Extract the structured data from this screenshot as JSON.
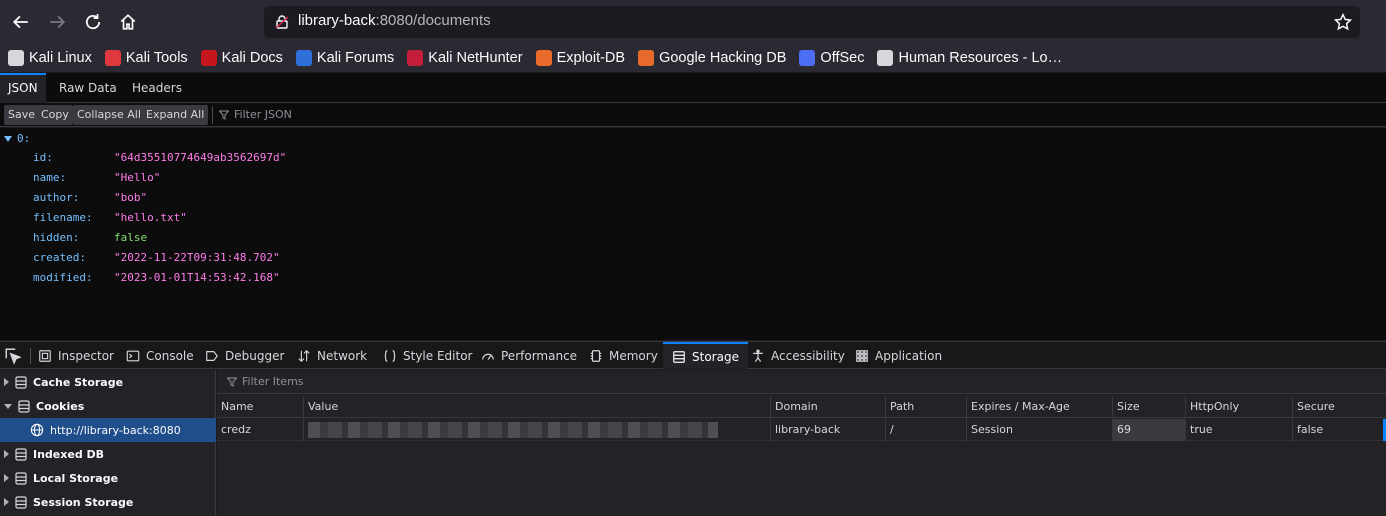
{
  "browser": {
    "url_host": "library-back",
    "url_rest": ":8080/documents",
    "bookmarks": [
      {
        "label": "Kali Linux",
        "color": "#d7d7db"
      },
      {
        "label": "Kali Tools",
        "color": "#e0383f"
      },
      {
        "label": "Kali Docs",
        "color": "#c4161c"
      },
      {
        "label": "Kali Forums",
        "color": "#2f6fdb"
      },
      {
        "label": "Kali NetHunter",
        "color": "#c41e3a"
      },
      {
        "label": "Exploit-DB",
        "color": "#e86a2b"
      },
      {
        "label": "Google Hacking DB",
        "color": "#e86a2b"
      },
      {
        "label": "OffSec",
        "color": "#4c6ef5"
      },
      {
        "label": "Human Resources - Lo…",
        "color": "#d7d7db"
      }
    ]
  },
  "json_viewer": {
    "tabs": [
      "JSON",
      "Raw Data",
      "Headers"
    ],
    "buttons": [
      "Save",
      "Copy",
      "Collapse All",
      "Expand All"
    ],
    "filter_placeholder": "Filter JSON",
    "root_key": "0:",
    "rows": [
      {
        "key": "id:",
        "value": "\"64d35510774649ab3562697d\"",
        "type": "str"
      },
      {
        "key": "name:",
        "value": "\"Hello\"",
        "type": "str"
      },
      {
        "key": "author:",
        "value": "\"bob\"",
        "type": "str"
      },
      {
        "key": "filename:",
        "value": "\"hello.txt\"",
        "type": "str"
      },
      {
        "key": "hidden:",
        "value": "false",
        "type": "bool"
      },
      {
        "key": "created:",
        "value": "\"2022-11-22T09:31:48.702\"",
        "type": "str"
      },
      {
        "key": "modified:",
        "value": "\"2023-01-01T14:53:42.168\"",
        "type": "str"
      }
    ]
  },
  "devtools": {
    "tabs": [
      "Inspector",
      "Console",
      "Debugger",
      "Network",
      "Style Editor",
      "Performance",
      "Memory",
      "Storage",
      "Accessibility",
      "Application"
    ],
    "active_tab": "Storage",
    "sidebar": [
      {
        "label": "Cache Storage",
        "state": "closed"
      },
      {
        "label": "Cookies",
        "state": "open"
      },
      {
        "label": "http://library-back:8080",
        "state": "selected"
      },
      {
        "label": "Indexed DB",
        "state": "closed"
      },
      {
        "label": "Local Storage",
        "state": "closed"
      },
      {
        "label": "Session Storage",
        "state": "closed"
      }
    ],
    "filter_placeholder": "Filter Items",
    "columns": [
      "Name",
      "Value",
      "Domain",
      "Path",
      "Expires / Max-Age",
      "Size",
      "HttpOnly",
      "Secure"
    ],
    "cookie": {
      "name": "credz",
      "value": "",
      "domain": "library-back",
      "path": "/",
      "expires": "Session",
      "size": "69",
      "httponly": "true",
      "secure": "false"
    }
  }
}
